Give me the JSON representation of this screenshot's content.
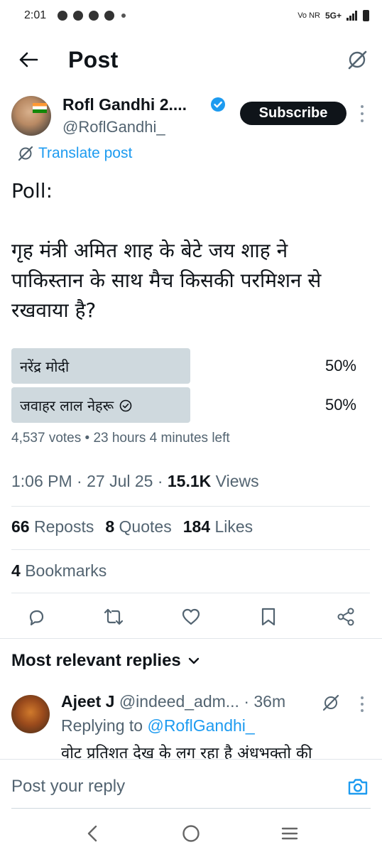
{
  "status_bar": {
    "time": "2:01",
    "network": "5G+",
    "carrier_badge": "Vo NR"
  },
  "header": {
    "title": "Post"
  },
  "author": {
    "name": "Rofl Gandhi 2....",
    "handle": "@RoflGandhi_",
    "subscribe_label": "Subscribe"
  },
  "translate_label": "Translate post",
  "post": {
    "line1": "Poll:",
    "line2": "गृह मंत्री अमित शाह के बेटे जय शाह ने",
    "line3": "पाकिस्तान के साथ मैच किसकी परमिशन से",
    "line4": "रखवाया है?"
  },
  "poll": {
    "options": [
      {
        "label": "नरेंद्र मोदी",
        "percent": "50%",
        "fraction": 0.5,
        "selected": false
      },
      {
        "label": "जवाहर लाल नेहरू",
        "percent": "50%",
        "fraction": 0.5,
        "selected": true
      }
    ],
    "meta": "4,537 votes • 23 hours 4 minutes left"
  },
  "timestamp": {
    "time_date": "1:06 PM · 27 Jul 25 · ",
    "views_count": "15.1K",
    "views_label": " Views"
  },
  "stats": {
    "reposts_count": "66",
    "reposts_label": "Reposts",
    "quotes_count": "8",
    "quotes_label": "Quotes",
    "likes_count": "184",
    "likes_label": "Likes",
    "bookmarks_count": "4",
    "bookmarks_label": "Bookmarks"
  },
  "replies_heading": "Most relevant replies",
  "reply": {
    "name": "Ajeet J",
    "handle": "@indeed_adm...",
    "age": "· 36m",
    "replying_prefix": "Replying to ",
    "replying_handle": "@RoflGandhi_",
    "text": "वोट प्रतिशत देख के लग रहा है अंधभक्तो की"
  },
  "composer": {
    "placeholder": "Post your reply"
  },
  "colors": {
    "accent": "#1d9bf0",
    "text": "#0f1419",
    "muted": "#536471",
    "poll_bar": "#cfd9de"
  }
}
